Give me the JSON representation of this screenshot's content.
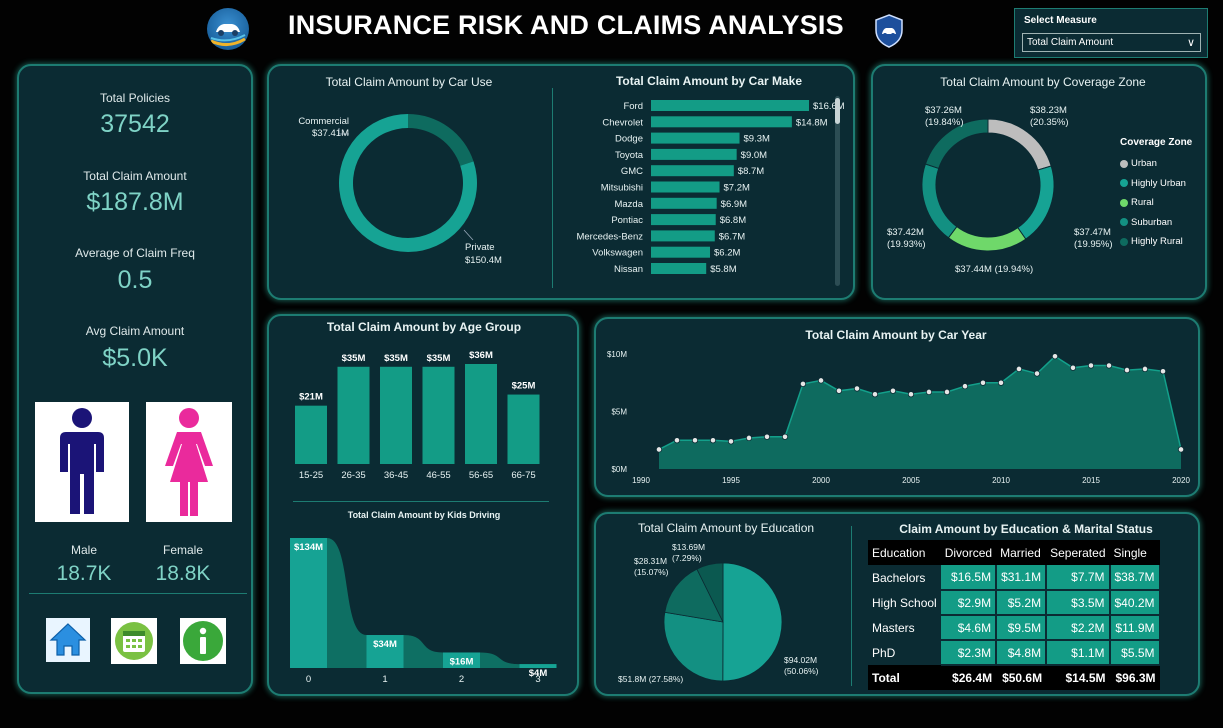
{
  "header": {
    "title": "INSURANCE RISK AND CLAIMS ANALYSIS",
    "logo_left_icon": "car-logo-icon",
    "logo_right_icon": "insurance-shield-icon"
  },
  "slicer": {
    "label": "Select Measure",
    "value": "Total Claim Amount"
  },
  "kpis": [
    {
      "label": "Total Policies",
      "value": "37542"
    },
    {
      "label": "Total Claim Amount",
      "value": "$187.8M"
    },
    {
      "label": "Average of Claim Freq",
      "value": "0.5"
    },
    {
      "label": "Avg Claim Amount",
      "value": "$5.0K"
    }
  ],
  "gender": {
    "male_label": "Male",
    "male_value": "18.7K",
    "female_label": "Female",
    "female_value": "18.8K"
  },
  "nav_icons": [
    "home-icon",
    "calendar-icon",
    "info-icon"
  ],
  "colors": {
    "teal": "#139c86",
    "light_teal": "#16a394",
    "dark_teal": "#0e6b5f",
    "urban_gray": "#bdbdbd",
    "rural_green": "#6fd86a",
    "kpi_text": "#7fd3c6",
    "male_navy": "#1b1477",
    "female_pink": "#ea2a9c"
  },
  "car_use": {
    "title": "Total Claim Amount by Car Use",
    "chart_data": {
      "type": "pie",
      "title": "Total Claim Amount by Car Use",
      "slices": [
        {
          "label": "Commercial",
          "value_label": "$37.41M",
          "value": 37.41
        },
        {
          "label": "Private",
          "value_label": "$150.4M",
          "value": 150.4
        }
      ]
    }
  },
  "car_make": {
    "title": "Total Claim Amount by Car Make",
    "chart_data": {
      "type": "bar",
      "title": "Total Claim Amount by Car Make",
      "orientation": "horizontal",
      "categories": [
        "Ford",
        "Chevrolet",
        "Dodge",
        "Toyota",
        "GMC",
        "Mitsubishi",
        "Mazda",
        "Pontiac",
        "Mercedes-Benz",
        "Volkswagen",
        "Nissan"
      ],
      "values": [
        16.6,
        14.8,
        9.3,
        9.0,
        8.7,
        7.2,
        6.9,
        6.8,
        6.7,
        6.2,
        5.8
      ],
      "value_labels": [
        "$16.6M",
        "$14.8M",
        "$9.3M",
        "$9.0M",
        "$8.7M",
        "$7.2M",
        "$6.9M",
        "$6.8M",
        "$6.7M",
        "$6.2M",
        "$5.8M"
      ]
    }
  },
  "coverage": {
    "title": "Total Claim Amount by Coverage Zone",
    "legend_title": "Coverage Zone",
    "chart_data": {
      "type": "pie",
      "title": "Total Claim Amount by Coverage Zone",
      "legend": "right",
      "slices": [
        {
          "label": "Urban",
          "value": 38.23,
          "value_label": "$38.23M",
          "pct_label": "(20.35%)",
          "color": "#bdbdbd"
        },
        {
          "label": "Highly Urban",
          "value": 37.47,
          "value_label": "$37.47M",
          "pct_label": "(19.95%)",
          "color": "#16a394"
        },
        {
          "label": "Rural",
          "value": 37.44,
          "value_label": "$37.44M (19.94%)",
          "pct_label": "",
          "color": "#6fd86a"
        },
        {
          "label": "Suburban",
          "value": 37.42,
          "value_label": "$37.42M",
          "pct_label": "(19.93%)",
          "color": "#139082"
        },
        {
          "label": "Highly Rural",
          "value": 37.26,
          "value_label": "$37.26M",
          "pct_label": "(19.84%)",
          "color": "#0e6b5f"
        }
      ]
    }
  },
  "age_group": {
    "title": "Total Claim Amount by Age Group",
    "chart_data": {
      "type": "bar",
      "title": "Total Claim Amount by Age Group",
      "categories": [
        "15-25",
        "26-35",
        "36-45",
        "46-55",
        "56-65",
        "66-75"
      ],
      "values": [
        21,
        35,
        35,
        35,
        36,
        25
      ],
      "value_labels": [
        "$21M",
        "$35M",
        "$35M",
        "$35M",
        "$36M",
        "$25M"
      ]
    }
  },
  "kids_driving": {
    "title": "Total Claim Amount by Kids Driving",
    "chart_data": {
      "type": "area",
      "title": "Total Claim Amount by Kids Driving",
      "categories": [
        "0",
        "1",
        "2",
        "3"
      ],
      "values": [
        134,
        34,
        16,
        4
      ],
      "value_labels": [
        "$134M",
        "$34M",
        "$16M",
        "$4M"
      ]
    }
  },
  "car_year": {
    "title": "Total Claim Amount by Car Year",
    "chart_data": {
      "type": "area",
      "title": "Total Claim Amount by Car Year",
      "y_ticks": [
        "$0M",
        "$5M",
        "$10M"
      ],
      "x_ticks": [
        "1990",
        "1995",
        "2000",
        "2005",
        "2010",
        "2015",
        "2020"
      ],
      "ylim": [
        0,
        10
      ],
      "xlim": [
        1990,
        2020
      ],
      "x": [
        1991,
        1992,
        1993,
        1994,
        1995,
        1996,
        1997,
        1998,
        1999,
        2000,
        2001,
        2002,
        2003,
        2004,
        2005,
        2006,
        2007,
        2008,
        2009,
        2010,
        2011,
        2012,
        2013,
        2014,
        2015,
        2016,
        2017,
        2018,
        2019,
        2020
      ],
      "values": [
        1.7,
        2.5,
        2.5,
        2.5,
        2.4,
        2.7,
        2.8,
        2.8,
        7.4,
        7.7,
        6.8,
        7.0,
        6.5,
        6.8,
        6.5,
        6.7,
        6.7,
        7.2,
        7.5,
        7.5,
        8.7,
        8.3,
        9.8,
        8.8,
        9.0,
        9.0,
        8.6,
        8.7,
        8.5,
        1.7
      ]
    }
  },
  "education": {
    "title": "Total Claim Amount by Education",
    "chart_data": {
      "type": "pie",
      "title": "Total Claim Amount by Education",
      "slices": [
        {
          "value": 94.02,
          "value_label": "$94.02M",
          "pct_label": "(50.06%)",
          "color": "#16a394"
        },
        {
          "value": 51.8,
          "value_label": "$51.8M (27.58%)",
          "pct_label": "",
          "color": "#139082"
        },
        {
          "value": 28.31,
          "value_label": "$28.31M",
          "pct_label": "(15.07%)",
          "color": "#0e6b5f"
        },
        {
          "value": 13.69,
          "value_label": "$13.69M",
          "pct_label": "(7.29%)",
          "color": "#0b5950"
        }
      ]
    }
  },
  "matrix": {
    "title": "Claim Amount by Education & Marital Status",
    "chart_data": {
      "type": "table",
      "columns": [
        "Education",
        "Divorced",
        "Married",
        "Seperated",
        "Single"
      ],
      "rows": [
        [
          "Bachelors",
          "$16.5M",
          "$31.1M",
          "$7.7M",
          "$38.7M"
        ],
        [
          "High School",
          "$2.9M",
          "$5.2M",
          "$3.5M",
          "$40.2M"
        ],
        [
          "Masters",
          "$4.6M",
          "$9.5M",
          "$2.2M",
          "$11.9M"
        ],
        [
          "PhD",
          "$2.3M",
          "$4.8M",
          "$1.1M",
          "$5.5M"
        ]
      ],
      "total": [
        "Total",
        "$26.4M",
        "$50.6M",
        "$14.5M",
        "$96.3M"
      ]
    }
  }
}
